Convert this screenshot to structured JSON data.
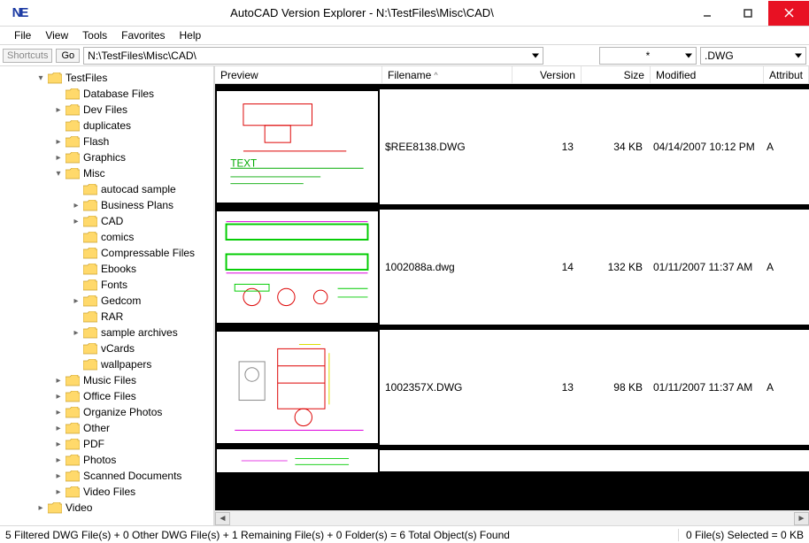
{
  "window": {
    "title": "AutoCAD Version Explorer - N:\\TestFiles\\Misc\\CAD\\",
    "app_glyph": "NE"
  },
  "menu": [
    "File",
    "View",
    "Tools",
    "Favorites",
    "Help"
  ],
  "toolbar": {
    "shortcuts_label": "Shortcuts",
    "go_label": "Go",
    "path": "N:\\TestFiles\\Misc\\CAD\\",
    "filter": "*",
    "ext": ".DWG"
  },
  "columns": {
    "preview": "Preview",
    "filename": "Filename",
    "version": "Version",
    "size": "Size",
    "modified": "Modified",
    "attributes": "Attribut"
  },
  "tree": [
    {
      "depth": 0,
      "twisty": "▾",
      "label": "TestFiles"
    },
    {
      "depth": 1,
      "twisty": "",
      "label": "Database Files"
    },
    {
      "depth": 1,
      "twisty": "▸",
      "label": "Dev Files"
    },
    {
      "depth": 1,
      "twisty": "",
      "label": "duplicates"
    },
    {
      "depth": 1,
      "twisty": "▸",
      "label": "Flash"
    },
    {
      "depth": 1,
      "twisty": "▸",
      "label": "Graphics"
    },
    {
      "depth": 1,
      "twisty": "▾",
      "label": "Misc"
    },
    {
      "depth": 2,
      "twisty": "",
      "label": "autocad sample"
    },
    {
      "depth": 2,
      "twisty": "▸",
      "label": "Business Plans"
    },
    {
      "depth": 2,
      "twisty": "▸",
      "label": "CAD"
    },
    {
      "depth": 2,
      "twisty": "",
      "label": "comics"
    },
    {
      "depth": 2,
      "twisty": "",
      "label": "Compressable Files"
    },
    {
      "depth": 2,
      "twisty": "",
      "label": "Ebooks"
    },
    {
      "depth": 2,
      "twisty": "",
      "label": "Fonts"
    },
    {
      "depth": 2,
      "twisty": "▸",
      "label": "Gedcom"
    },
    {
      "depth": 2,
      "twisty": "",
      "label": "RAR"
    },
    {
      "depth": 2,
      "twisty": "▸",
      "label": "sample archives"
    },
    {
      "depth": 2,
      "twisty": "",
      "label": "vCards"
    },
    {
      "depth": 2,
      "twisty": "",
      "label": "wallpapers"
    },
    {
      "depth": 1,
      "twisty": "▸",
      "label": "Music Files"
    },
    {
      "depth": 1,
      "twisty": "▸",
      "label": "Office Files"
    },
    {
      "depth": 1,
      "twisty": "▸",
      "label": "Organize Photos"
    },
    {
      "depth": 1,
      "twisty": "▸",
      "label": "Other"
    },
    {
      "depth": 1,
      "twisty": "▸",
      "label": "PDF"
    },
    {
      "depth": 1,
      "twisty": "▸",
      "label": "Photos"
    },
    {
      "depth": 1,
      "twisty": "▸",
      "label": "Scanned Documents"
    },
    {
      "depth": 1,
      "twisty": "▸",
      "label": "Video Files"
    },
    {
      "depth": 0,
      "twisty": "▸",
      "label": "Video"
    }
  ],
  "files": [
    {
      "filename": "$REE8138.DWG",
      "version": "13",
      "size": "34 KB",
      "modified": "04/14/2007 10:12 PM",
      "attributes": "A"
    },
    {
      "filename": "1002088a.dwg",
      "version": "14",
      "size": "132 KB",
      "modified": "01/11/2007 11:37 AM",
      "attributes": "A"
    },
    {
      "filename": "1002357X.DWG",
      "version": "13",
      "size": "98 KB",
      "modified": "01/11/2007 11:37 AM",
      "attributes": "A"
    }
  ],
  "status": {
    "left": "5 Filtered DWG File(s) + 0 Other DWG File(s) + 1 Remaining File(s) + 0 Folder(s)  =  6 Total Object(s) Found",
    "right": "0 File(s) Selected = 0 KB"
  }
}
